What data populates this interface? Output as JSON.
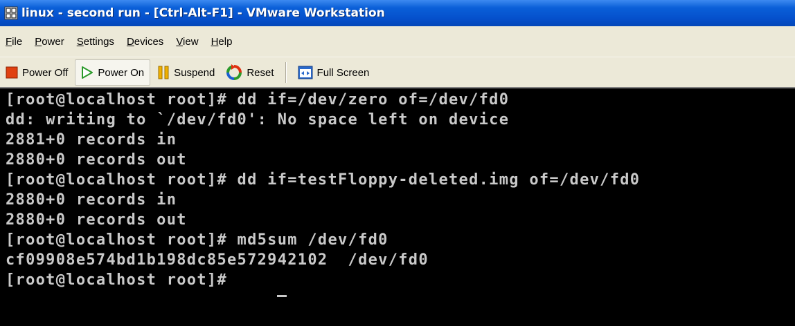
{
  "window": {
    "title": "linux - second run - [Ctrl-Alt-F1] - VMware Workstation",
    "title_icon": "vmware-app-icon"
  },
  "menu": [
    {
      "mnemonic": "F",
      "rest": "ile"
    },
    {
      "mnemonic": "P",
      "rest": "ower"
    },
    {
      "mnemonic": "S",
      "rest": "ettings"
    },
    {
      "mnemonic": "D",
      "rest": "evices"
    },
    {
      "mnemonic": "V",
      "rest": "iew"
    },
    {
      "mnemonic": "H",
      "rest": "elp"
    }
  ],
  "toolbar": {
    "power_off": "Power Off",
    "power_on": "Power On",
    "suspend": "Suspend",
    "reset": "Reset",
    "full_screen": "Full Screen"
  },
  "colors": {
    "titlebar": "#0550cc",
    "console_bg": "#000000",
    "console_fg": "#c9c9c9",
    "power_off_icon": "#e04010",
    "power_on_icon": "#2a9a2a",
    "suspend_icon": "#f0b000"
  },
  "console": {
    "lines": [
      "[root@localhost root]# dd if=/dev/zero of=/dev/fd0",
      "dd: writing to `/dev/fd0': No space left on device",
      "2881+0 records in",
      "2880+0 records out",
      "[root@localhost root]# dd if=testFloppy-deleted.img of=/dev/fd0",
      "2880+0 records in",
      "2880+0 records out",
      "[root@localhost root]# md5sum /dev/fd0",
      "cf09908e574bd1b198dc85e572942102  /dev/fd0",
      "[root@localhost root]# "
    ]
  }
}
